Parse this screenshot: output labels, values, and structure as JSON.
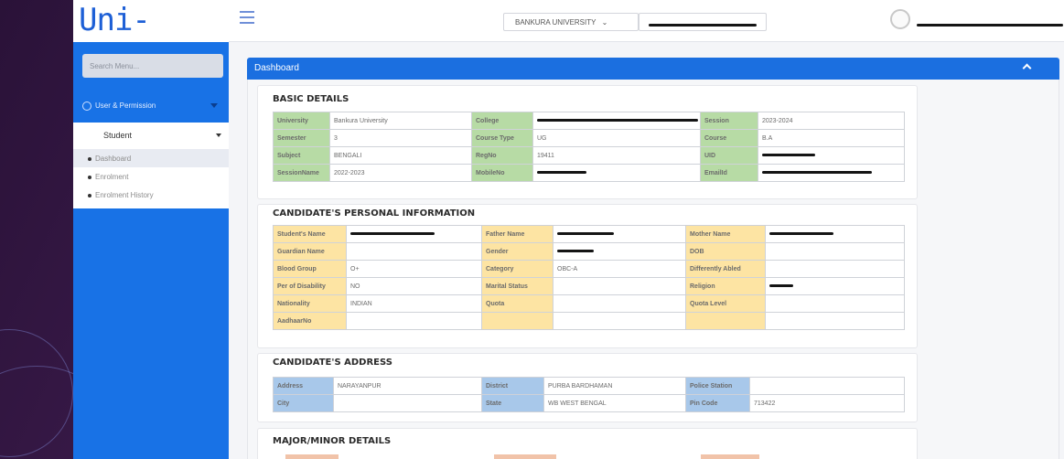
{
  "brand": {
    "logo_text": "Uni-Track"
  },
  "header": {
    "university_select": "BANKURA UNIVERSITY",
    "university_caret": "⌄"
  },
  "sidebar": {
    "search_placeholder": "Search Menu...",
    "section_label": "User & Permission",
    "group_label": "Student",
    "items": [
      {
        "label": "Dashboard",
        "active": true
      },
      {
        "label": "Enrolment",
        "active": false
      },
      {
        "label": "Enrolment History",
        "active": false
      }
    ]
  },
  "panel": {
    "title": "Dashboard"
  },
  "basic": {
    "title": "BASIC DETAILS",
    "rows": [
      [
        "University",
        "Bankura University",
        "College",
        "",
        "Session",
        "2023-2024"
      ],
      [
        "Semester",
        "3",
        "Course Type",
        "UG",
        "Course",
        "B.A"
      ],
      [
        "Subject",
        "BENGALI",
        "RegNo",
        "19411",
        "UID",
        ""
      ],
      [
        "SessionName",
        "2022-2023",
        "MobileNo",
        "",
        "EmailId",
        ""
      ]
    ]
  },
  "personal": {
    "title": "CANDIDATE'S PERSONAL INFORMATION",
    "rows": [
      [
        "Student's Name",
        "",
        "Father Name",
        "",
        "Mother Name",
        ""
      ],
      [
        "Guardian Name",
        "",
        "Gender",
        "",
        "DOB",
        ""
      ],
      [
        "Blood Group",
        "O+",
        "Category",
        "OBC-A",
        "Differently Abled",
        ""
      ],
      [
        "Per of Disability",
        "NO",
        "Marital Status",
        "",
        "Religion",
        ""
      ],
      [
        "Nationality",
        "INDIAN",
        "Quota",
        "",
        "Quota Level",
        ""
      ],
      [
        "AadhaarNo",
        "",
        "",
        "",
        "",
        ""
      ]
    ]
  },
  "address": {
    "title": "CANDIDATE'S ADDRESS",
    "rows": [
      [
        "Address",
        "NARAYANPUR",
        "District",
        "PURBA BARDHAMAN",
        "Police Station",
        ""
      ],
      [
        "City",
        "",
        "State",
        "WB   WEST BENGAL",
        "Pin Code",
        "713422"
      ]
    ]
  },
  "major": {
    "title": "MAJOR/MINOR DETAILS"
  },
  "colors": {
    "accent": "#1b6fe0",
    "sidebar": "#1872e6",
    "green_label": "#b7dba5",
    "yellow_label": "#fde4a3",
    "blue_label": "#a8c8ea"
  }
}
